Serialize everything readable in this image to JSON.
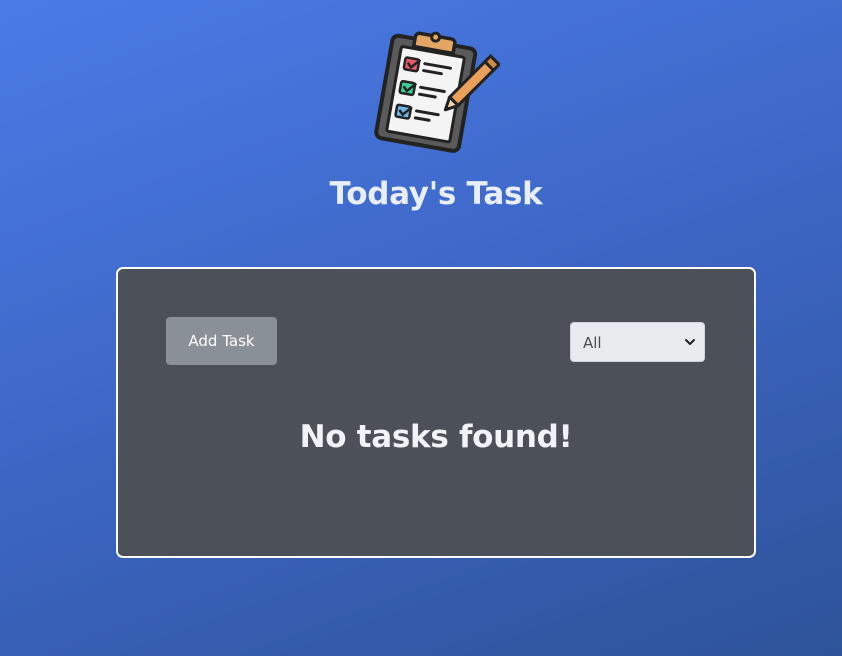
{
  "app": {
    "title": "Today's Task",
    "logo_icon": "clipboard-checklist-icon"
  },
  "card": {
    "add_button_label": "Add Task",
    "filter": {
      "selected": "All"
    },
    "empty_message": "No tasks found!"
  },
  "colors": {
    "background_top": "#4a7be6",
    "background_bottom": "#2e5399",
    "card_bg": "#4b5059",
    "button_bg": "#8a9097"
  }
}
